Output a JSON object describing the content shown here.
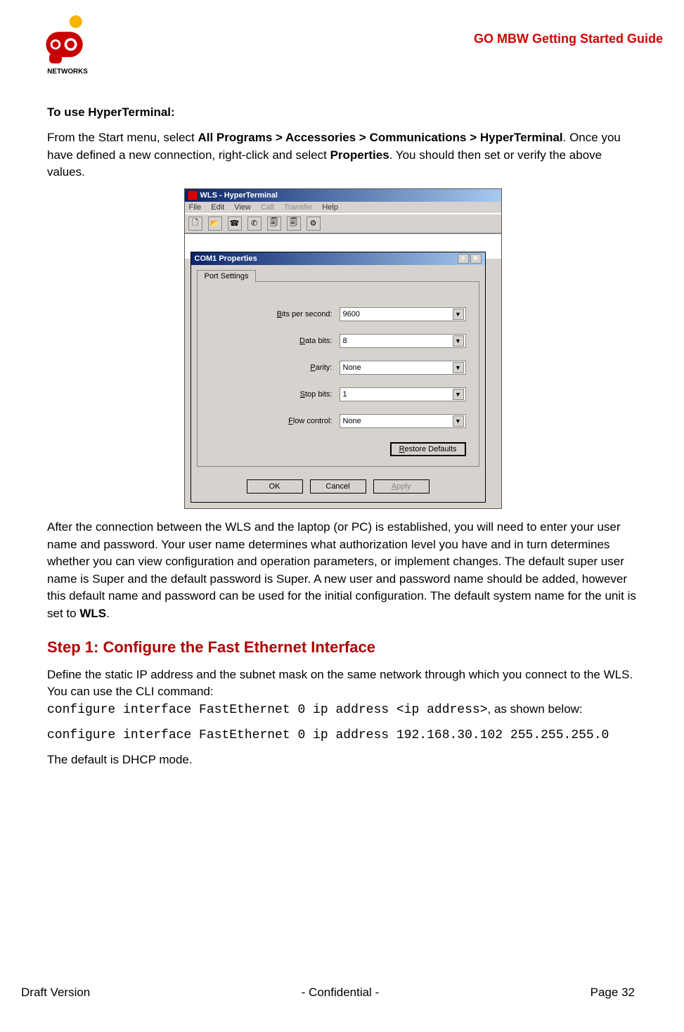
{
  "header": {
    "doc_title": "GO MBW Getting Started Guide",
    "logo_brand_top": "go",
    "logo_brand_bottom": "NETWORKS"
  },
  "section": {
    "sub_heading": "To use HyperTerminal:",
    "intro_1a": "From the Start menu, select ",
    "intro_1b": "All Programs > Accessories > Communications > HyperTerminal",
    "intro_1c": ". Once you have defined a new connection, right-click and select ",
    "intro_1d": "Properties",
    "intro_1e": ". You should then set or verify the above values.",
    "after_para_a": "After the connection between the WLS and the laptop (or PC) is established,  you will need to enter your user name and password. Your user name determines what authorization level you have and in turn determines whether you can view configuration and operation parameters, or implement changes. The default super user name is Super and the default password is Super. A new user and password name should be added, however this default name and password can be used for the initial configuration. The default system name for the unit is set to ",
    "after_para_b": "WLS",
    "after_para_c": ".",
    "step1_heading": "Step 1: Configure the Fast Ethernet Interface",
    "step1_para1": "Define the static IP address and the subnet mask on the same network through which you connect to the WLS. You can use the CLI command:",
    "step1_code1": "configure interface FastEthernet 0 ip address <ip address>",
    "step1_para1_tail": ", as shown below:",
    "step1_code2": "configure interface FastEthernet 0 ip address 192.168.30.102 255.255.255.0",
    "step1_para2": "The default is DHCP mode."
  },
  "hyperterm": {
    "title": "WLS - HyperTerminal",
    "menus": [
      "File",
      "Edit",
      "View",
      "Call",
      "Transfer",
      "Help"
    ]
  },
  "dialog": {
    "title": "COM1 Properties",
    "tab": "Port Settings",
    "rows": {
      "bps": {
        "label_pre": "B",
        "label_post": "its per second:",
        "value": "9600"
      },
      "databits": {
        "label_pre": "D",
        "label_post": "ata bits:",
        "value": "8"
      },
      "parity": {
        "label_pre": "P",
        "label_post": "arity:",
        "value": "None"
      },
      "stopbits": {
        "label_pre": "S",
        "label_post": "top bits:",
        "value": "1"
      },
      "flow": {
        "label_pre": "F",
        "label_post": "low control:",
        "value": "None"
      }
    },
    "restore": "Restore Defaults",
    "ok": "OK",
    "cancel": "Cancel",
    "apply": "Apply"
  },
  "footer": {
    "left": "Draft Version",
    "center": "-   Confidential   -",
    "right": "Page 32"
  }
}
